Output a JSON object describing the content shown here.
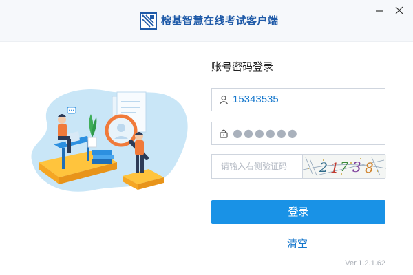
{
  "window": {
    "title": "榕基智慧在线考试客户端",
    "controls": {
      "minimize": "minimize-icon",
      "close": "close-icon"
    },
    "brand_color": "#1f5aa8"
  },
  "login": {
    "heading": "账号密码登录",
    "username": "15343535",
    "password_masked": "●●●●●●",
    "captcha_placeholder": "请输入右侧验证码",
    "captcha_image_text": "21738",
    "submit_label": "登录",
    "clear_label": "清空"
  },
  "footer": {
    "version": "Ver.1.2.1.62"
  },
  "colors": {
    "accent": "#1992e6",
    "link": "#1577cc",
    "border": "#cfd5de"
  }
}
